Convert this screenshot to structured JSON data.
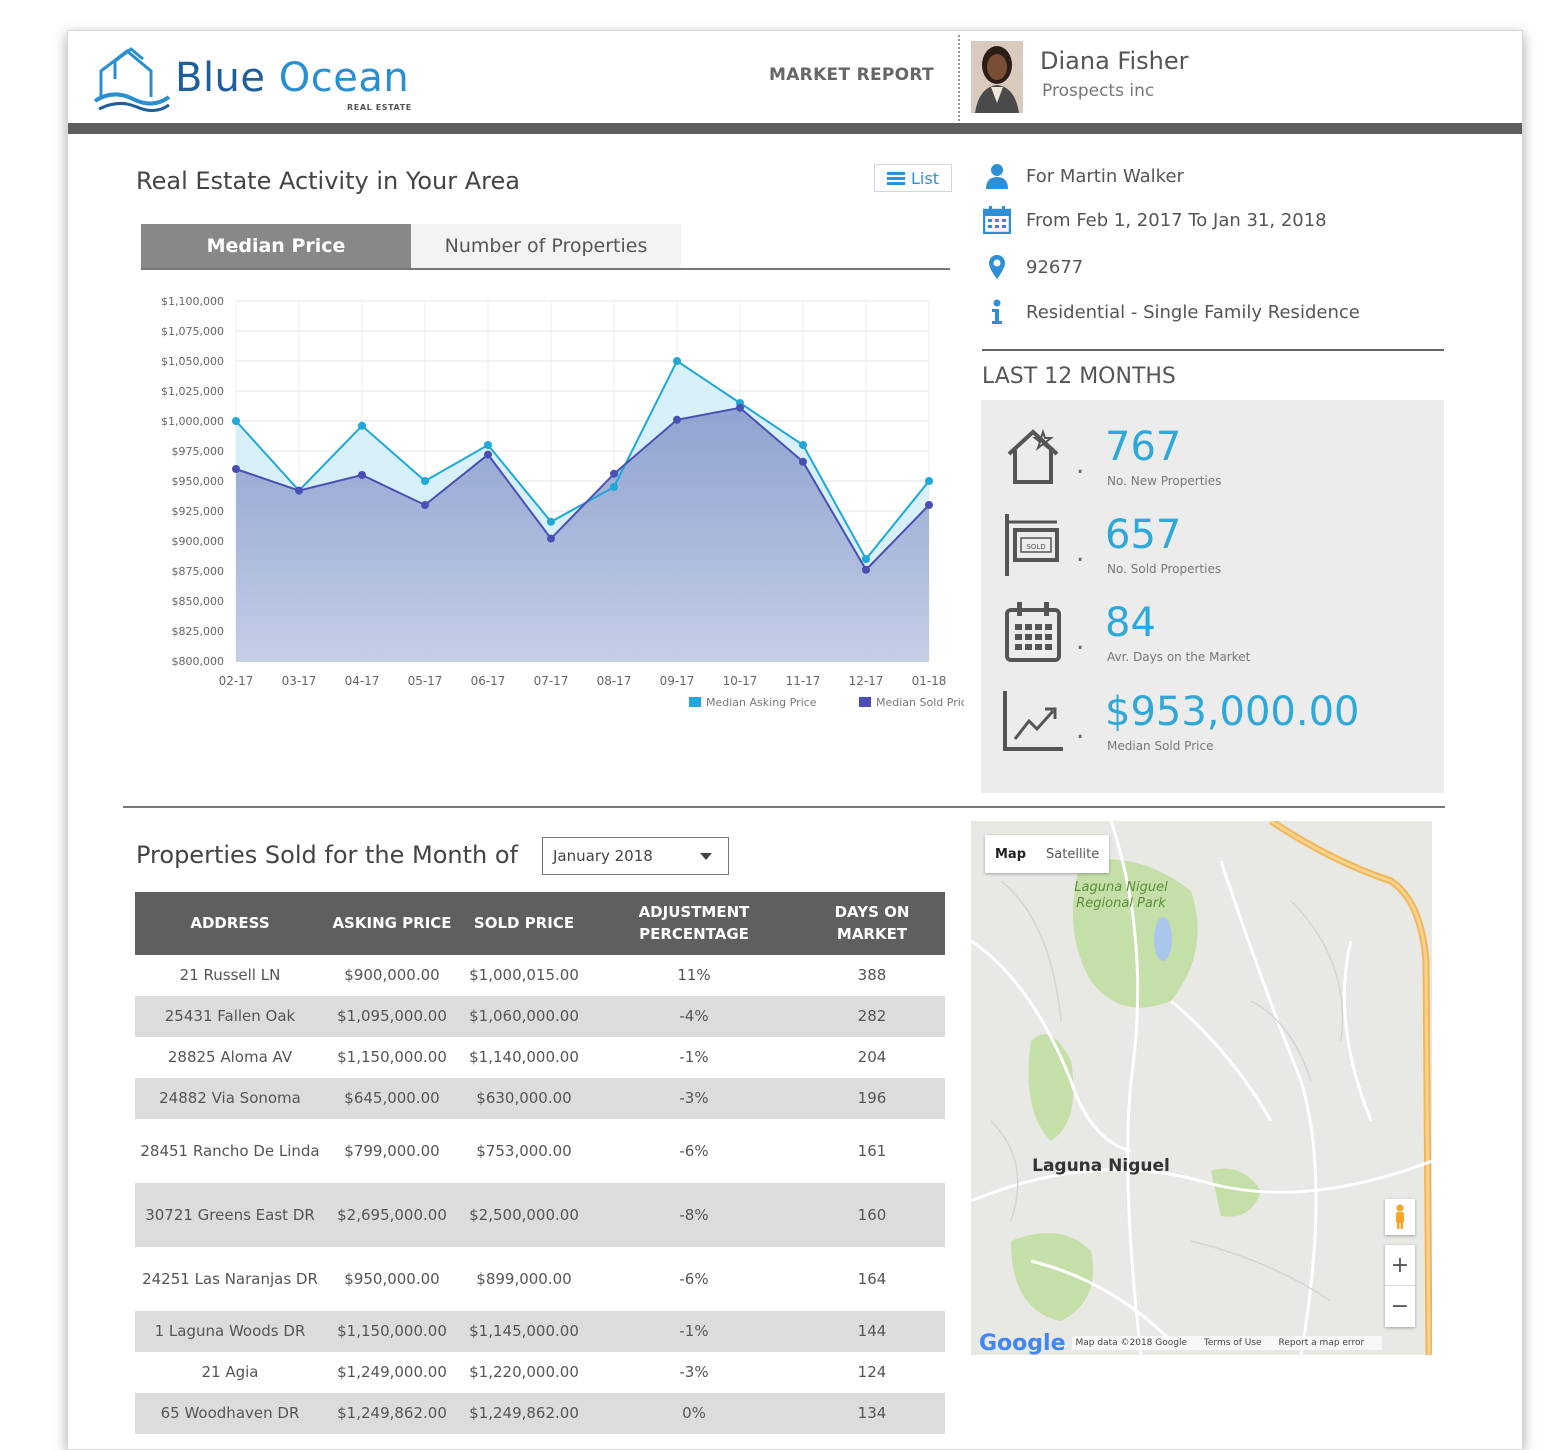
{
  "brand": {
    "name_part1": "Blue",
    "name_part2": "Ocean",
    "subtitle": "REAL ESTATE",
    "report_label": "MARKET REPORT"
  },
  "agent": {
    "name": "Diana Fisher",
    "company": "Prospects inc"
  },
  "activity": {
    "title": "Real Estate Activity in Your Area",
    "list_button": "List",
    "tabs": [
      {
        "label": "Median Price",
        "active": true
      },
      {
        "label": "Number of Properties",
        "active": false
      }
    ]
  },
  "chart_data": {
    "type": "area",
    "categories": [
      "02-17",
      "03-17",
      "04-17",
      "05-17",
      "06-17",
      "07-17",
      "08-17",
      "09-17",
      "10-17",
      "11-17",
      "12-17",
      "01-18"
    ],
    "series": [
      {
        "name": "Median Asking Price",
        "color": "#1fa8d8",
        "values": [
          1000000,
          942000,
          996000,
          950000,
          980000,
          916000,
          945000,
          1050000,
          1015000,
          980000,
          885000,
          950000
        ]
      },
      {
        "name": "Median Sold Price",
        "color": "#4a4fb5",
        "values": [
          960000,
          942000,
          955000,
          930000,
          972000,
          902000,
          956000,
          1001000,
          1011000,
          966000,
          876000,
          930000
        ]
      }
    ],
    "ylim": [
      800000,
      1100000
    ],
    "yticks": [
      "$1,100,000",
      "$1,075,000",
      "$1,050,000",
      "$1,025,000",
      "$1,000,000",
      "$975,000",
      "$950,000",
      "$925,000",
      "$900,000",
      "$875,000",
      "$850,000",
      "$825,000",
      "$800,000"
    ],
    "grid": true,
    "legend": "bottom-right"
  },
  "criteria": {
    "client": "For Martin Walker",
    "date_range": "From Feb 1, 2017 To Jan 31, 2018",
    "zip": "92677",
    "property_type": "Residential - Single Family Residence"
  },
  "stats": {
    "heading": "LAST 12 MONTHS",
    "dot": ".",
    "items": [
      {
        "value": "767",
        "label": "No. New Properties",
        "icon": "house-star-icon"
      },
      {
        "value": "657",
        "label": "No. Sold Properties",
        "icon": "sold-sign-icon"
      },
      {
        "value": "84",
        "label": "Avr. Days on the Market",
        "icon": "calendar-icon"
      },
      {
        "value": "$953,000.00",
        "label": "Median Sold Price",
        "icon": "trend-up-icon"
      }
    ]
  },
  "sold": {
    "title": "Properties Sold for the Month of",
    "selected_month": "January 2018",
    "columns": [
      "ADDRESS",
      "ASKING PRICE",
      "SOLD PRICE",
      "ADJUSTMENT PERCENTAGE",
      "DAYS ON MARKET"
    ],
    "rows": [
      [
        "21 Russell LN",
        "$900,000.00",
        "$1,000,015.00",
        "11%",
        "388"
      ],
      [
        "25431 Fallen Oak",
        "$1,095,000.00",
        "$1,060,000.00",
        "-4%",
        "282"
      ],
      [
        "28825 Aloma AV",
        "$1,150,000.00",
        "$1,140,000.00",
        "-1%",
        "204"
      ],
      [
        "24882 Via Sonoma",
        "$645,000.00",
        "$630,000.00",
        "-3%",
        "196"
      ],
      [
        "28451 Rancho De Linda",
        "$799,000.00",
        "$753,000.00",
        "-6%",
        "161"
      ],
      [
        "30721 Greens East DR",
        "$2,695,000.00",
        "$2,500,000.00",
        "-8%",
        "160"
      ],
      [
        "24251 Las Naranjas DR",
        "$950,000.00",
        "$899,000.00",
        "-6%",
        "164"
      ],
      [
        "1 Laguna Woods DR",
        "$1,150,000.00",
        "$1,145,000.00",
        "-1%",
        "144"
      ],
      [
        "21 Agia",
        "$1,249,000.00",
        "$1,220,000.00",
        "-3%",
        "124"
      ],
      [
        "65 Woodhaven DR",
        "$1,249,862.00",
        "$1,249,862.00",
        "0%",
        "134"
      ]
    ]
  },
  "map": {
    "btn_map": "Map",
    "btn_satellite": "Satellite",
    "place_main": "Laguna Niguel",
    "place_park_1": "Laguna Niguel",
    "place_park_2": "Regional Park",
    "google": "Google",
    "attrib_data": "Map data ©2018 Google",
    "attrib_terms": "Terms of Use",
    "attrib_report": "Report a map error",
    "zoom_in": "+",
    "zoom_out": "−",
    "colors": {
      "land": "#e8e8e4",
      "green": "#c5dfa8",
      "water": "#a9c7ec",
      "highway": "#f2b65a",
      "road": "#ffffff"
    }
  }
}
